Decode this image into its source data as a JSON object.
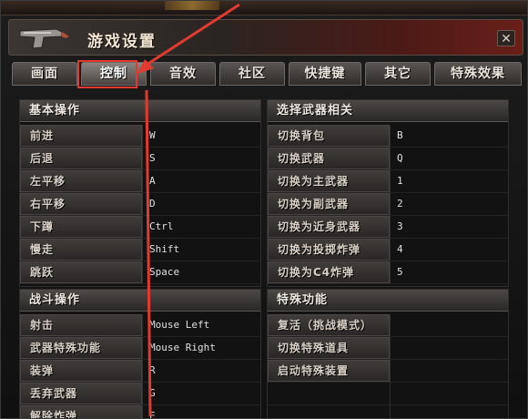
{
  "window": {
    "title": "游戏设置",
    "close_icon": "close-icon"
  },
  "tabs": [
    {
      "label": "画面",
      "active": false
    },
    {
      "label": "控制",
      "active": true
    },
    {
      "label": "音效",
      "active": false
    },
    {
      "label": "社区",
      "active": false
    },
    {
      "label": "快捷键",
      "active": false
    },
    {
      "label": "其它",
      "active": false
    },
    {
      "label": "特殊效果",
      "active": false
    }
  ],
  "basic": {
    "title": "基本操作",
    "rows": [
      {
        "label": "前进",
        "value": "W"
      },
      {
        "label": "后退",
        "value": "S"
      },
      {
        "label": "左平移",
        "value": "A"
      },
      {
        "label": "右平移",
        "value": "D"
      },
      {
        "label": "下蹲",
        "value": "Ctrl"
      },
      {
        "label": "慢走",
        "value": "Shift"
      },
      {
        "label": "跳跃",
        "value": "Space"
      }
    ]
  },
  "weapons": {
    "title": "选择武器相关",
    "rows": [
      {
        "label": "切换背包",
        "value": "B"
      },
      {
        "label": "切换武器",
        "value": "Q"
      },
      {
        "label": "切换为主武器",
        "value": "1"
      },
      {
        "label": "切换为副武器",
        "value": "2"
      },
      {
        "label": "切换为近身武器",
        "value": "3"
      },
      {
        "label": "切换为投掷炸弹",
        "value": "4"
      },
      {
        "label": "切换为C4炸弹",
        "value": "5"
      }
    ]
  },
  "combat": {
    "title": "战斗操作",
    "rows": [
      {
        "label": "射击",
        "value": "Mouse Left"
      },
      {
        "label": "武器特殊功能",
        "value": "Mouse Right"
      },
      {
        "label": "装弹",
        "value": "R"
      },
      {
        "label": "丢弃武器",
        "value": "G"
      },
      {
        "label": "解除炸弹",
        "value": "E"
      }
    ]
  },
  "special": {
    "title": "特殊功能",
    "rows": [
      {
        "label": "复活（挑战模式）",
        "value": ""
      },
      {
        "label": "切换特殊道具",
        "value": ""
      },
      {
        "label": "启动特殊装置",
        "value": ""
      },
      {
        "label": "",
        "value": ""
      },
      {
        "label": "",
        "value": ""
      }
    ]
  },
  "colors": {
    "annotation": "#e23a30",
    "accent": "#6a1f18"
  }
}
